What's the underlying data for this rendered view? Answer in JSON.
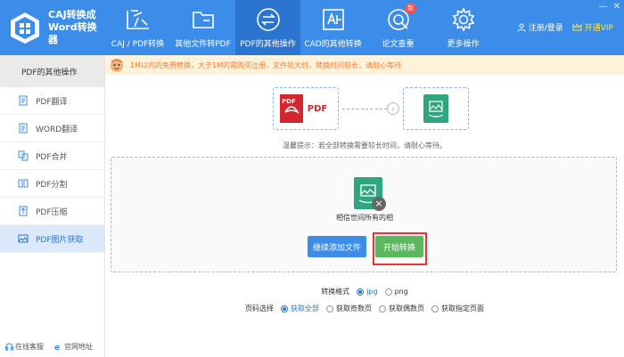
{
  "app": {
    "title": "CAJ转换成\nWord转换\n器"
  },
  "nav": [
    {
      "label": "CAJ / PDF转换",
      "icon": "caj-pdf-icon"
    },
    {
      "label": "其他文件转PDF",
      "icon": "folder-icon"
    },
    {
      "label": "PDF的其他操作",
      "icon": "exchange-icon",
      "active": true
    },
    {
      "label": "CAD的其他转换",
      "icon": "cad-icon"
    },
    {
      "label": "论文查重",
      "icon": "check-paper-icon",
      "badge": "新"
    },
    {
      "label": "更多操作",
      "icon": "gear-icon"
    }
  ],
  "account": {
    "login": "注册/登录",
    "vip": "开通VIP"
  },
  "sidebar": {
    "header": "PDF的其他操作",
    "items": [
      {
        "label": "PDF翻译"
      },
      {
        "label": "WORD翻译"
      },
      {
        "label": "PDF合并"
      },
      {
        "label": "PDF分割"
      },
      {
        "label": "PDF压缩"
      },
      {
        "label": "PDF图片获取",
        "active": true
      }
    ],
    "footer": {
      "service": "在线客服",
      "website": "官网地址"
    }
  },
  "notice": "1M以内的免费转换，大于1M的需购买注册，文件较大时，转换时间较长，请耐心等待",
  "flow": {
    "source_label": "PDF",
    "pdf_small": "PDF"
  },
  "tip": "温馨提示：若全部转换需要较长时间，请耐心等待。",
  "file": {
    "name": "相信世间所有的相"
  },
  "buttons": {
    "add": "继续添加文件",
    "start": "开始转换"
  },
  "format": {
    "label": "转换格式",
    "options": [
      "jpg",
      "png"
    ],
    "selected": "jpg"
  },
  "pages": {
    "label": "页码选择",
    "options": [
      "获取全部",
      "获取奇数页",
      "获取偶数页",
      "获取指定页面"
    ],
    "selected": "获取全部"
  },
  "colors": {
    "primary": "#3c8dea",
    "active_nav": "#2b74cf",
    "start": "#5cb85c",
    "pdf_red": "#d3272f",
    "image_green": "#2fa67f"
  }
}
